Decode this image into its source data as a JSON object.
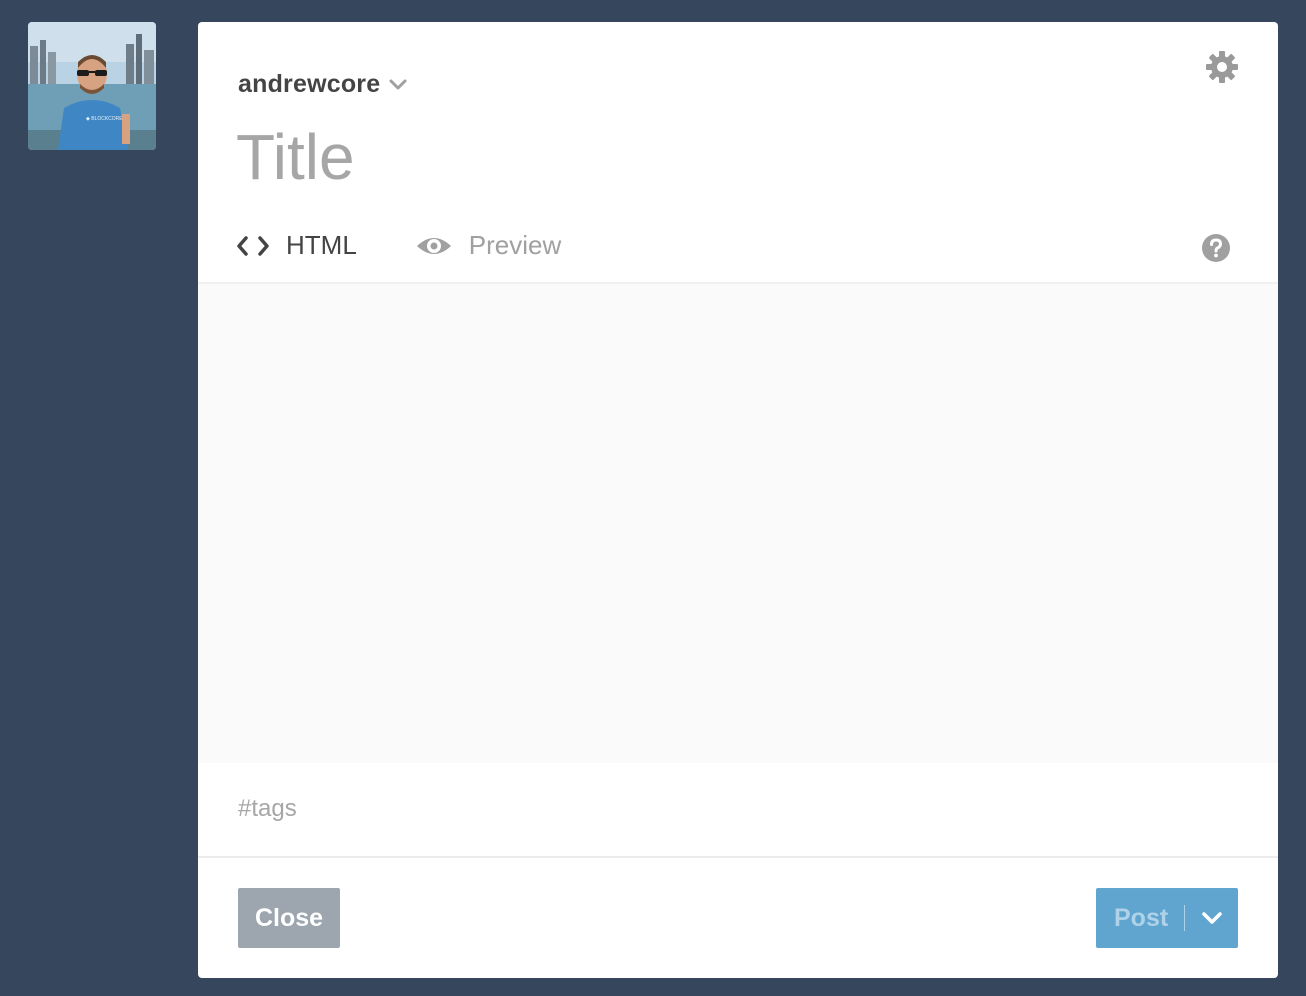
{
  "sidebar": {
    "avatar_alt": "User avatar"
  },
  "composer": {
    "blog_name": "andrewcore",
    "title_placeholder": "Title",
    "tabs": [
      {
        "label": "HTML",
        "icon": "code-icon",
        "active": true
      },
      {
        "label": "Preview",
        "icon": "eye-icon",
        "active": false
      }
    ],
    "tags_placeholder": "#tags",
    "close_label": "Close",
    "post_label": "Post"
  },
  "colors": {
    "background": "#36465d",
    "accent": "#529ecc",
    "close_button": "#9da6af"
  }
}
